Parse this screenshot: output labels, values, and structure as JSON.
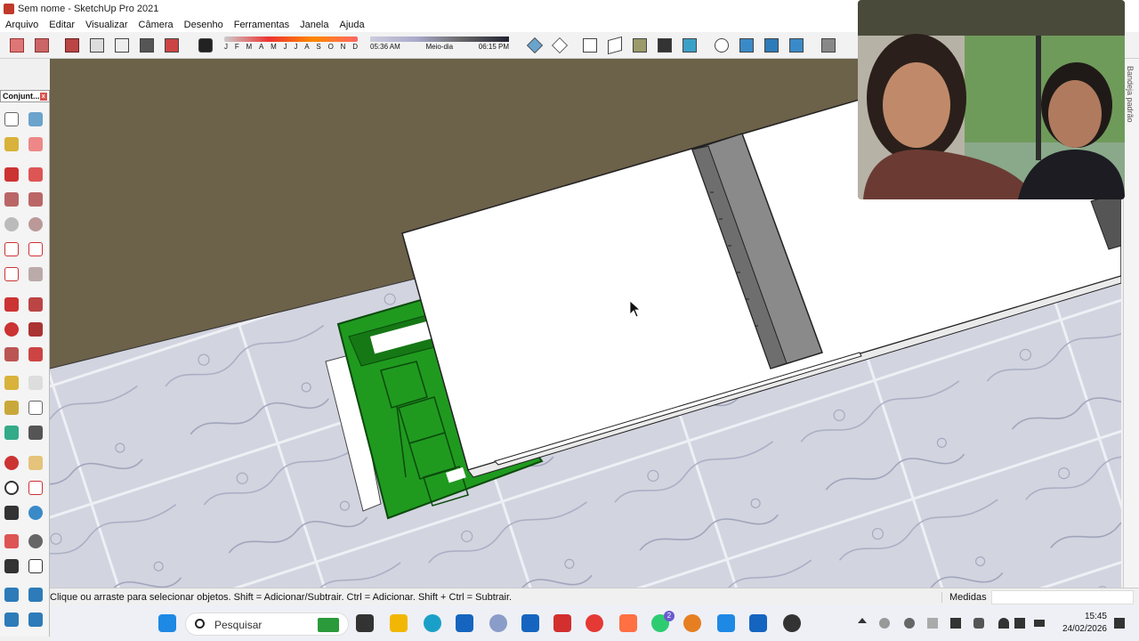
{
  "window": {
    "title": "Sem nome - SketchUp Pro 2021"
  },
  "menu": [
    "Arquivo",
    "Editar",
    "Visualizar",
    "Câmera",
    "Desenho",
    "Ferramentas",
    "Janela",
    "Ajuda"
  ],
  "shadows": {
    "months": [
      "J",
      "F",
      "M",
      "A",
      "M",
      "J",
      "J",
      "A",
      "S",
      "O",
      "N",
      "D"
    ],
    "time_start": "05:36 AM",
    "time_mid": "Meio-dia",
    "time_end": "06:15 PM"
  },
  "palette": {
    "title": "Conjunt...",
    "close": "x"
  },
  "side_tray": {
    "label": "Bandeja padrão"
  },
  "status": {
    "message": "Clique ou arraste para selecionar objetos. Shift = Adicionar/Subtrair. Ctrl = Adicionar. Shift + Ctrl = Subtrair.",
    "measures_label": "Medidas",
    "measures_value": ""
  },
  "taskbar": {
    "search_placeholder": "Pesquisar",
    "whatsapp_badge": "2",
    "time": "15:45",
    "date": "24/02/2026"
  },
  "colors": {
    "ground": "#6c6149",
    "floor": "#c8cbd8",
    "furniture_green": "#1f9a1f",
    "roof_white": "#ffffff",
    "gutter_gray": "#8a8a8a"
  }
}
